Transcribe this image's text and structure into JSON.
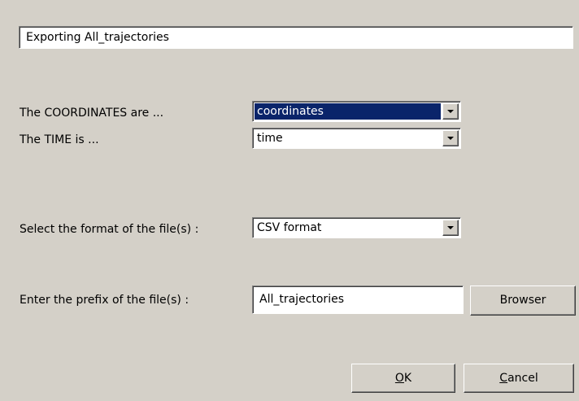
{
  "dialog": {
    "title_text": "Exporting All_trajectories"
  },
  "coordinates": {
    "label": "The COORDINATES are ...",
    "value": "coordinates"
  },
  "time": {
    "label": "The TIME is ...",
    "value": "time"
  },
  "format": {
    "label": "Select the format of the file(s) :",
    "value": "CSV format"
  },
  "prefix": {
    "label": "Enter the prefix of the file(s) :",
    "value": "All_trajectories"
  },
  "buttons": {
    "browser_label": "Browser",
    "ok_mnemonic": "O",
    "ok_rest": "K",
    "cancel_mnemonic": "C",
    "cancel_rest": "ancel"
  },
  "icons": {
    "dropdown": "chevron-down-icon"
  },
  "colors": {
    "dialog_bg": "#d4d0c8",
    "selection_bg": "#0a246a",
    "selection_fg": "#ffffff"
  }
}
